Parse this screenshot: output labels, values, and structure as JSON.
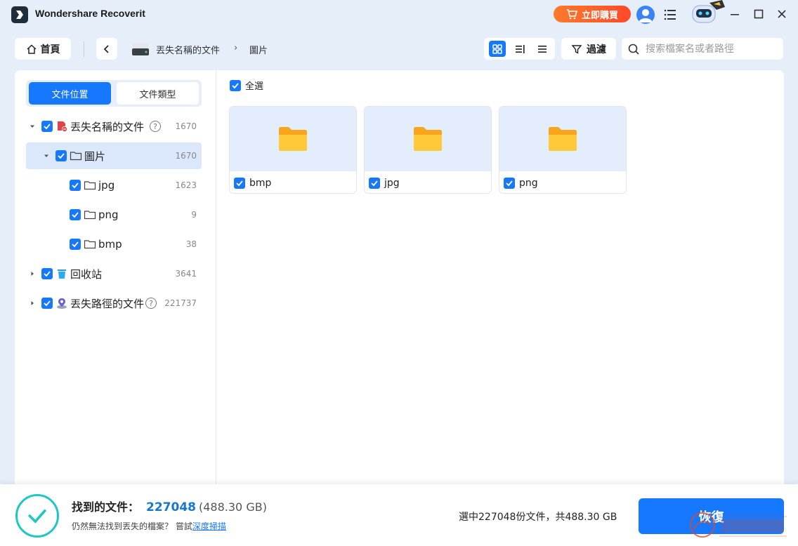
{
  "app": {
    "title": "Wondershare Recoverit"
  },
  "header": {
    "buy_label": "立即購買"
  },
  "toolbar": {
    "home_label": "首頁",
    "breadcrumb": [
      "丟失名稱的文件",
      "圖片"
    ],
    "breadcrumb_separator": "›",
    "filter_label": "過濾",
    "search_placeholder": "搜索檔案名或者路徑"
  },
  "sidebar": {
    "tabs": [
      {
        "label": "文件位置",
        "active": true
      },
      {
        "label": "文件類型",
        "active": false
      }
    ],
    "tree": [
      {
        "label": "丟失名稱的文件",
        "count": "1670",
        "icon": "lost-name-icon",
        "expanded": true
      },
      {
        "label": "圖片",
        "count": "1670",
        "icon": "folder-icon",
        "expanded": true,
        "selected": true
      },
      {
        "label": "jpg",
        "count": "1623",
        "icon": "folder-icon"
      },
      {
        "label": "png",
        "count": "9",
        "icon": "folder-icon"
      },
      {
        "label": "bmp",
        "count": "38",
        "icon": "folder-icon"
      },
      {
        "label": "回收站",
        "count": "3641",
        "icon": "recycle-bin-icon"
      },
      {
        "label": "丟失路徑的文件",
        "count": "221737",
        "icon": "lost-path-icon"
      }
    ]
  },
  "content": {
    "select_all_label": "全選",
    "folders": [
      {
        "name": "bmp"
      },
      {
        "name": "jpg"
      },
      {
        "name": "png"
      }
    ]
  },
  "footer": {
    "found_label": "找到的文件：",
    "found_count": "227048",
    "found_size": "(488.30 GB)",
    "hint_text": "仍然無法找到丟失的檔案？ 嘗試",
    "hint_link": "深度掃描",
    "selected_info": "選中227048份文件，共488.30 GB",
    "recover_label": "恢復"
  },
  "colors": {
    "accent": "#1677ff",
    "buy": "#ff5a2a",
    "done": "#1ec6c6"
  }
}
